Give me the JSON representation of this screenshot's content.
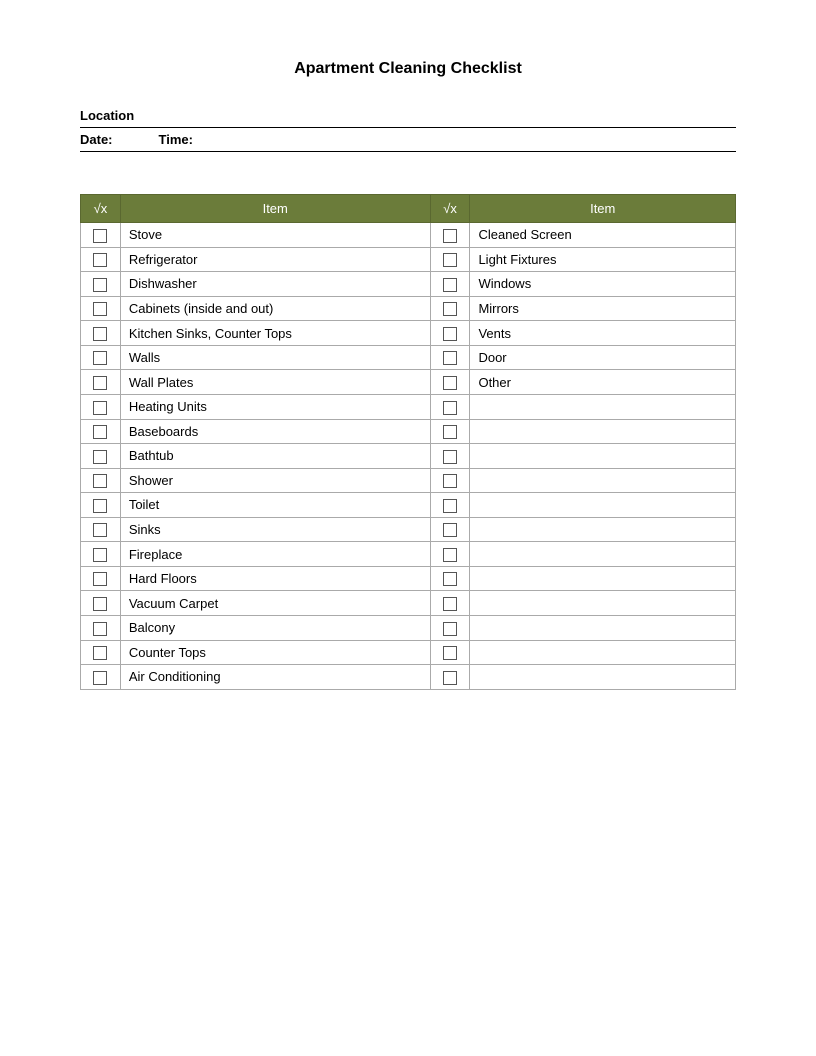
{
  "title": "Apartment Cleaning Checklist",
  "location_label": "Location",
  "date_label": "Date:",
  "time_label": "Time:",
  "table": {
    "header_check": "√x",
    "header_item": "Item",
    "left_items": [
      "Stove",
      "Refrigerator",
      "Dishwasher",
      "Cabinets  (inside and out)",
      "Kitchen Sinks, Counter Tops",
      "Walls",
      "Wall Plates",
      "Heating Units",
      "Baseboards",
      "Bathtub",
      "Shower",
      "Toilet",
      "Sinks",
      "Fireplace",
      "Hard Floors",
      "Vacuum Carpet",
      "Balcony",
      "Counter Tops",
      "Air Conditioning"
    ],
    "right_items": [
      "Cleaned Screen",
      "Light Fixtures",
      "Windows",
      "Mirrors",
      "Vents",
      "Door",
      "Other",
      "",
      "",
      "",
      "",
      "",
      "",
      "",
      "",
      "",
      "",
      "",
      ""
    ]
  }
}
